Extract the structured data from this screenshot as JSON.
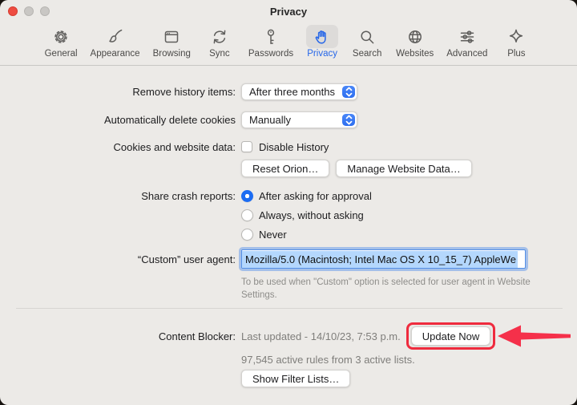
{
  "window": {
    "title": "Privacy"
  },
  "toolbar": {
    "items": [
      {
        "label": "General",
        "icon": "gear-icon",
        "selected": false
      },
      {
        "label": "Appearance",
        "icon": "paintbrush-icon",
        "selected": false
      },
      {
        "label": "Browsing",
        "icon": "browser-window-icon",
        "selected": false
      },
      {
        "label": "Sync",
        "icon": "sync-arrows-icon",
        "selected": false
      },
      {
        "label": "Passwords",
        "icon": "key-icon",
        "selected": false
      },
      {
        "label": "Privacy",
        "icon": "hand-icon",
        "selected": true
      },
      {
        "label": "Search",
        "icon": "magnifier-icon",
        "selected": false
      },
      {
        "label": "Websites",
        "icon": "globe-icon",
        "selected": false
      },
      {
        "label": "Advanced",
        "icon": "sliders-icon",
        "selected": false
      },
      {
        "label": "Plus",
        "icon": "sparkle-icon",
        "selected": false
      }
    ]
  },
  "rows": {
    "history": {
      "label": "Remove history items:",
      "value": "After three months"
    },
    "cookies": {
      "label": "Automatically delete cookies",
      "value": "Manually"
    },
    "website_data": {
      "label": "Cookies and website data:",
      "checkbox_label": "Disable History",
      "checked": false,
      "buttons": [
        "Reset Orion…",
        "Manage Website Data…"
      ]
    },
    "crash": {
      "label": "Share crash reports:",
      "options": [
        "After asking for approval",
        "Always, without asking",
        "Never"
      ],
      "selected_index": 0
    },
    "user_agent": {
      "label": "“Custom” user agent:",
      "value": "Mozilla/5.0 (Macintosh; Intel Mac OS X 10_15_7) AppleWe",
      "help": "To be used when \"Custom\" option is selected for user agent in Website Settings."
    },
    "content_blocker": {
      "label": "Content Blocker:",
      "status": "Last updated - 14/10/23, 7:53 p.m.",
      "update_button": "Update Now",
      "rules": "97,545 active rules from 3 active lists.",
      "filter_button": "Show Filter Lists…"
    }
  },
  "colors": {
    "accent_blue": "#2566E8",
    "popup_blue": "#3478F6",
    "radio_blue": "#1C6CF2",
    "selection_blue": "#B4D7FD",
    "annotation_red": "#EF2B3E",
    "window_bg": "#ECEAE7"
  }
}
